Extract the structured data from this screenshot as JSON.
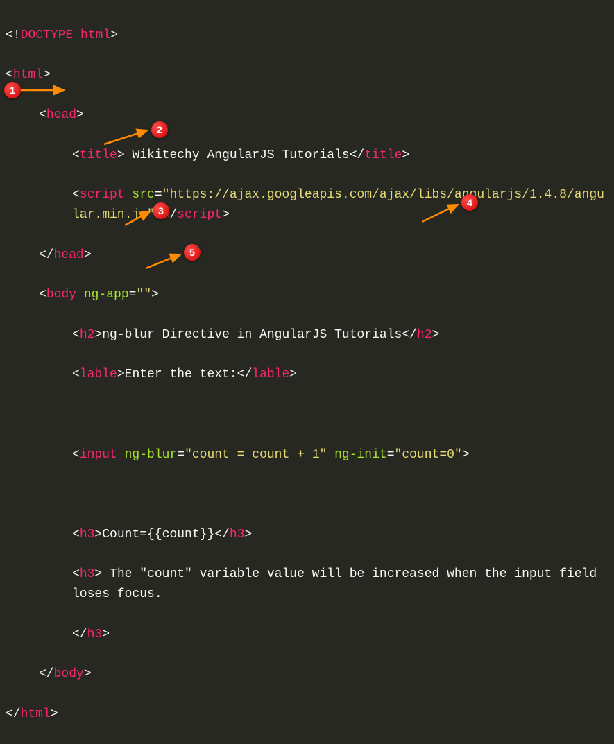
{
  "code": {
    "doctype_open": "<!",
    "doctype_tag": "DOCTYPE html",
    "doctype_close": ">",
    "html_open": "<",
    "html_tag": "html",
    "html_close": ">",
    "head_open": "<",
    "head_tag": "head",
    "head_close": ">",
    "title_open": "<",
    "title_tag": "title",
    "title_close": ">",
    "title_text": " Wikitechy AngularJS Tutorials",
    "title_end_open": "</",
    "title_end_close": ">",
    "script_open": "<",
    "script_tag": "script",
    "src_attr": " src",
    "eq": "=",
    "src_val": "\"https://ajax.googleapis.com/ajax/libs/angularjs/1.4.8/angular.min.js\"",
    "script_close": ">",
    "script_end_open": "</",
    "script_end_close": ">",
    "head_end_open": "</",
    "head_end_close": ">",
    "body_open": "<",
    "body_tag": "body",
    "ngapp_attr": " ng-app",
    "ngapp_val": "\"\"",
    "body_close": ">",
    "h2_open": "<",
    "h2_tag": "h2",
    "h2_close": ">",
    "h2_text": "ng-blur Directive in AngularJS Tutorials",
    "h2_end_open": "</",
    "h2_end_close": ">",
    "lable_open": "<",
    "lable_tag": "lable",
    "lable_close": ">",
    "lable_text": "Enter the text:",
    "lable_end_open": "</",
    "lable_end_close": ">",
    "input_open": "<",
    "input_tag": "input",
    "ngblur_attr": " ng-blur",
    "ngblur_val": "\"count = count + 1\"",
    "nginit_attr": " ng-init",
    "nginit_val": "\"count=0\"",
    "input_close": ">",
    "h3_open": "<",
    "h3_tag": "h3",
    "h3_close": ">",
    "h3_text": "Count={{count}}",
    "h3_end_open": "</",
    "h3_end_close": ">",
    "h3b_text": " The \"count\" variable value will be increased when the input field loses focus.",
    "body_end_open": "</",
    "body_end_close": ">",
    "html_end_open": "</",
    "html_end_close": ">"
  },
  "badges": {
    "b1": "1",
    "b2": "2",
    "b3": "3",
    "b4": "4",
    "b5": "5"
  }
}
